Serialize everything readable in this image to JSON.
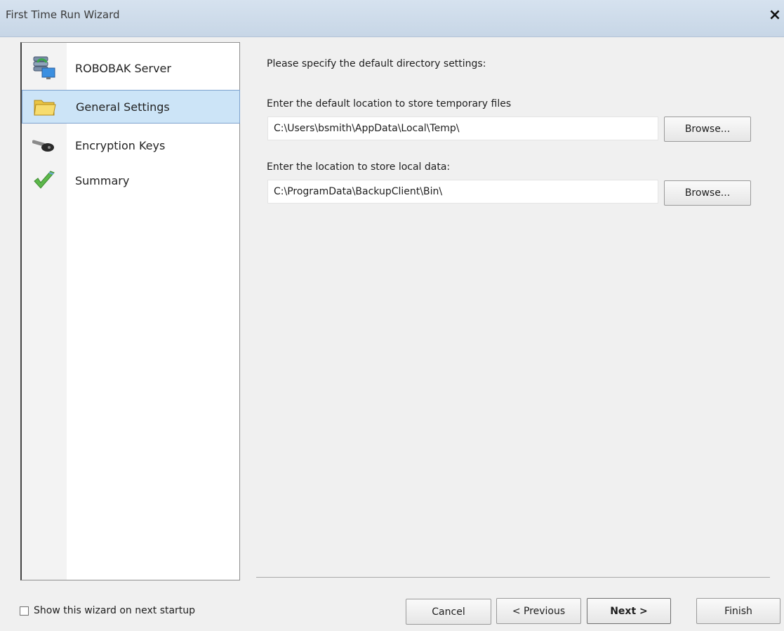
{
  "window": {
    "title": "First Time Run Wizard",
    "close_glyph": "×"
  },
  "nav": {
    "items": [
      {
        "label": "ROBOBAK Server",
        "icon": "server-icon"
      },
      {
        "label": "General Settings",
        "icon": "folder-icon",
        "selected": true
      },
      {
        "label": "Encryption Keys",
        "icon": "key-icon"
      },
      {
        "label": "Summary",
        "icon": "checkmark-icon"
      }
    ]
  },
  "content": {
    "prompt": "Please specify the default directory settings:",
    "temp_label": "Enter the default location to store temporary files",
    "temp_value": "C:\\Users\\bsmith\\AppData\\Local\\Temp\\",
    "local_label": "Enter the location to store local data:",
    "local_value": "C:\\ProgramData\\BackupClient\\Bin\\",
    "browse_label": "Browse..."
  },
  "footer": {
    "show_wizard_label": "Show this wizard on next startup",
    "show_wizard_checked": false,
    "cancel": "Cancel",
    "previous": "< Previous",
    "next": "Next >",
    "finish": "Finish"
  },
  "colors": {
    "selection": "#cce4f7",
    "selection_border": "#7da2ce",
    "titlebar": "#c7d6e6"
  }
}
